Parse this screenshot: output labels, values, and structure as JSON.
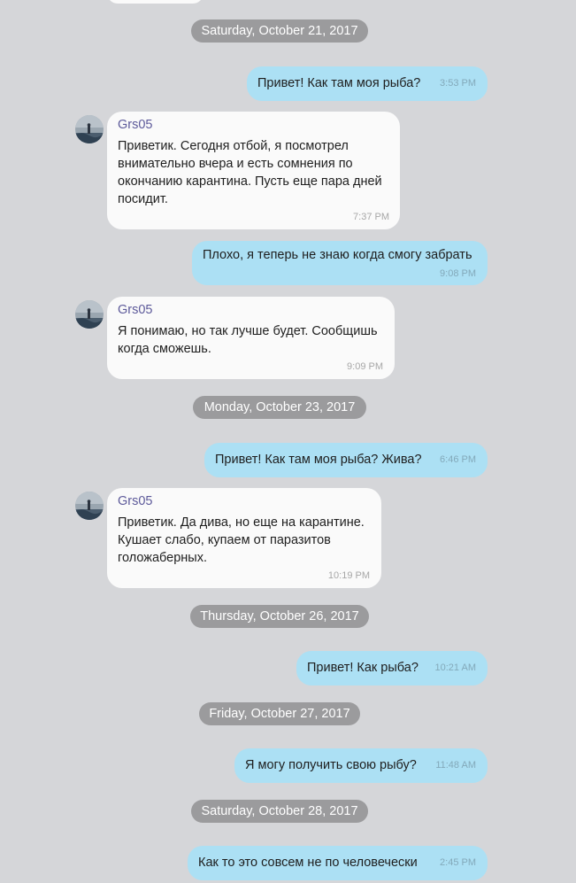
{
  "chat": {
    "dates": [
      "Saturday, October 21, 2017",
      "Monday, October 23, 2017",
      "Thursday, October 26, 2017",
      "Friday, October 27, 2017",
      "Saturday, October 28, 2017"
    ],
    "messages": [
      {
        "direction": "out",
        "text": "Привет! Как там моя рыба?",
        "time": "3:53 PM"
      },
      {
        "direction": "in",
        "sender": "Grs05",
        "lines": [
          "Приветик. Сегодня отбой, я посмотрел",
          "внимательно вчера и есть сомнения по",
          "окончанию карантина. Пусть еще пара дней",
          "посидит."
        ],
        "time": "7:37 PM"
      },
      {
        "direction": "out",
        "text": "Плохо, я теперь не знаю когда смогу забрать",
        "time": "9:08 PM"
      },
      {
        "direction": "in",
        "sender": "Grs05",
        "lines": [
          "Я понимаю, но так лучше будет. Сообщишь",
          "когда сможешь."
        ],
        "time": "9:09 PM"
      },
      {
        "direction": "out",
        "text": "Привет! Как там моя рыба? Жива?",
        "time": "6:46 PM"
      },
      {
        "direction": "in",
        "sender": "Grs05",
        "lines": [
          "Приветик. Да дива, но еще на карантине.",
          "Кушает слабо, купаем от паразитов",
          "голожаберных."
        ],
        "time": "10:19 PM"
      },
      {
        "direction": "out",
        "text": "Привет! Как рыба?",
        "time": "10:21 AM"
      },
      {
        "direction": "out",
        "text": "Я могу получить свою рыбу?",
        "time": "11:48 AM"
      },
      {
        "direction": "out",
        "text": "Как то это совсем не по человечески",
        "time": "2:45 PM"
      }
    ],
    "avatar_icon": "user-photo-avatar",
    "colors": {
      "background": "#d5d6d9",
      "incoming_bubble": "#fafafa",
      "outgoing_bubble": "#ace0f4",
      "date_pill": "#9b9b9d",
      "sender_name": "#5d5a9a"
    }
  }
}
